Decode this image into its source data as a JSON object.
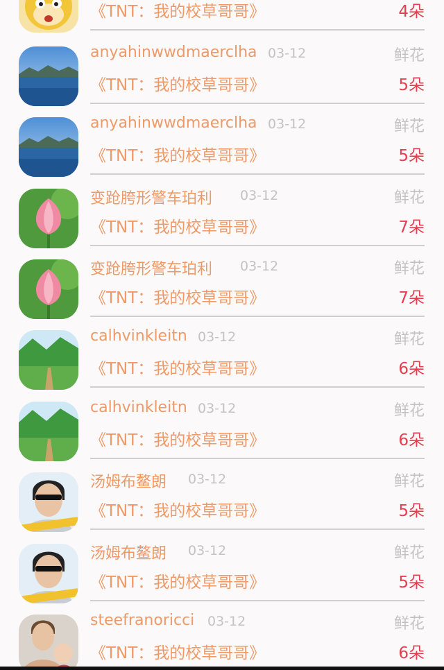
{
  "list": {
    "items": [
      {
        "name": "",
        "date": "",
        "gift_type": "",
        "book": "《TNT：我的校草哥哥》",
        "count": "4朵",
        "avatar_icon": "cartoon-avatar-icon"
      },
      {
        "name": "anyahinwwdmaerclha",
        "date": "03-12",
        "gift_type": "鲜花",
        "book": "《TNT：我的校草哥哥》",
        "count": "5朵",
        "avatar_icon": "lake-landscape-avatar-icon"
      },
      {
        "name": "anyahinwwdmaerclha",
        "date": "03-12",
        "gift_type": "鲜花",
        "book": "《TNT：我的校草哥哥》",
        "count": "5朵",
        "avatar_icon": "lake-landscape-avatar-icon"
      },
      {
        "name": "变跄胯形警车珀利",
        "date": "03-12",
        "gift_type": "鲜花",
        "book": "《TNT：我的校草哥哥》",
        "count": "7朵",
        "avatar_icon": "lotus-avatar-icon"
      },
      {
        "name": "变跄胯形警车珀利",
        "date": "03-12",
        "gift_type": "鲜花",
        "book": "《TNT：我的校草哥哥》",
        "count": "7朵",
        "avatar_icon": "lotus-avatar-icon"
      },
      {
        "name": "calhvinkleitn",
        "date": "03-12",
        "gift_type": "鲜花",
        "book": "《TNT：我的校草哥哥》",
        "count": "6朵",
        "avatar_icon": "green-hills-avatar-icon"
      },
      {
        "name": "calhvinkleitn",
        "date": "03-12",
        "gift_type": "鲜花",
        "book": "《TNT：我的校草哥哥》",
        "count": "6朵",
        "avatar_icon": "green-hills-avatar-icon"
      },
      {
        "name": "汤姆布鳌朗",
        "date": "03-12",
        "gift_type": "鲜花",
        "book": "《TNT：我的校草哥哥》",
        "count": "5朵",
        "avatar_icon": "person-sunglasses-avatar-icon"
      },
      {
        "name": "汤姆布鳌朗",
        "date": "03-12",
        "gift_type": "鲜花",
        "book": "《TNT：我的校草哥哥》",
        "count": "5朵",
        "avatar_icon": "person-sunglasses-avatar-icon"
      },
      {
        "name": "steefranoricci",
        "date": "03-12",
        "gift_type": "鲜花",
        "book": "《TNT：我的校草哥哥》",
        "count": "6朵",
        "avatar_icon": "person-with-baby-avatar-icon"
      }
    ]
  }
}
